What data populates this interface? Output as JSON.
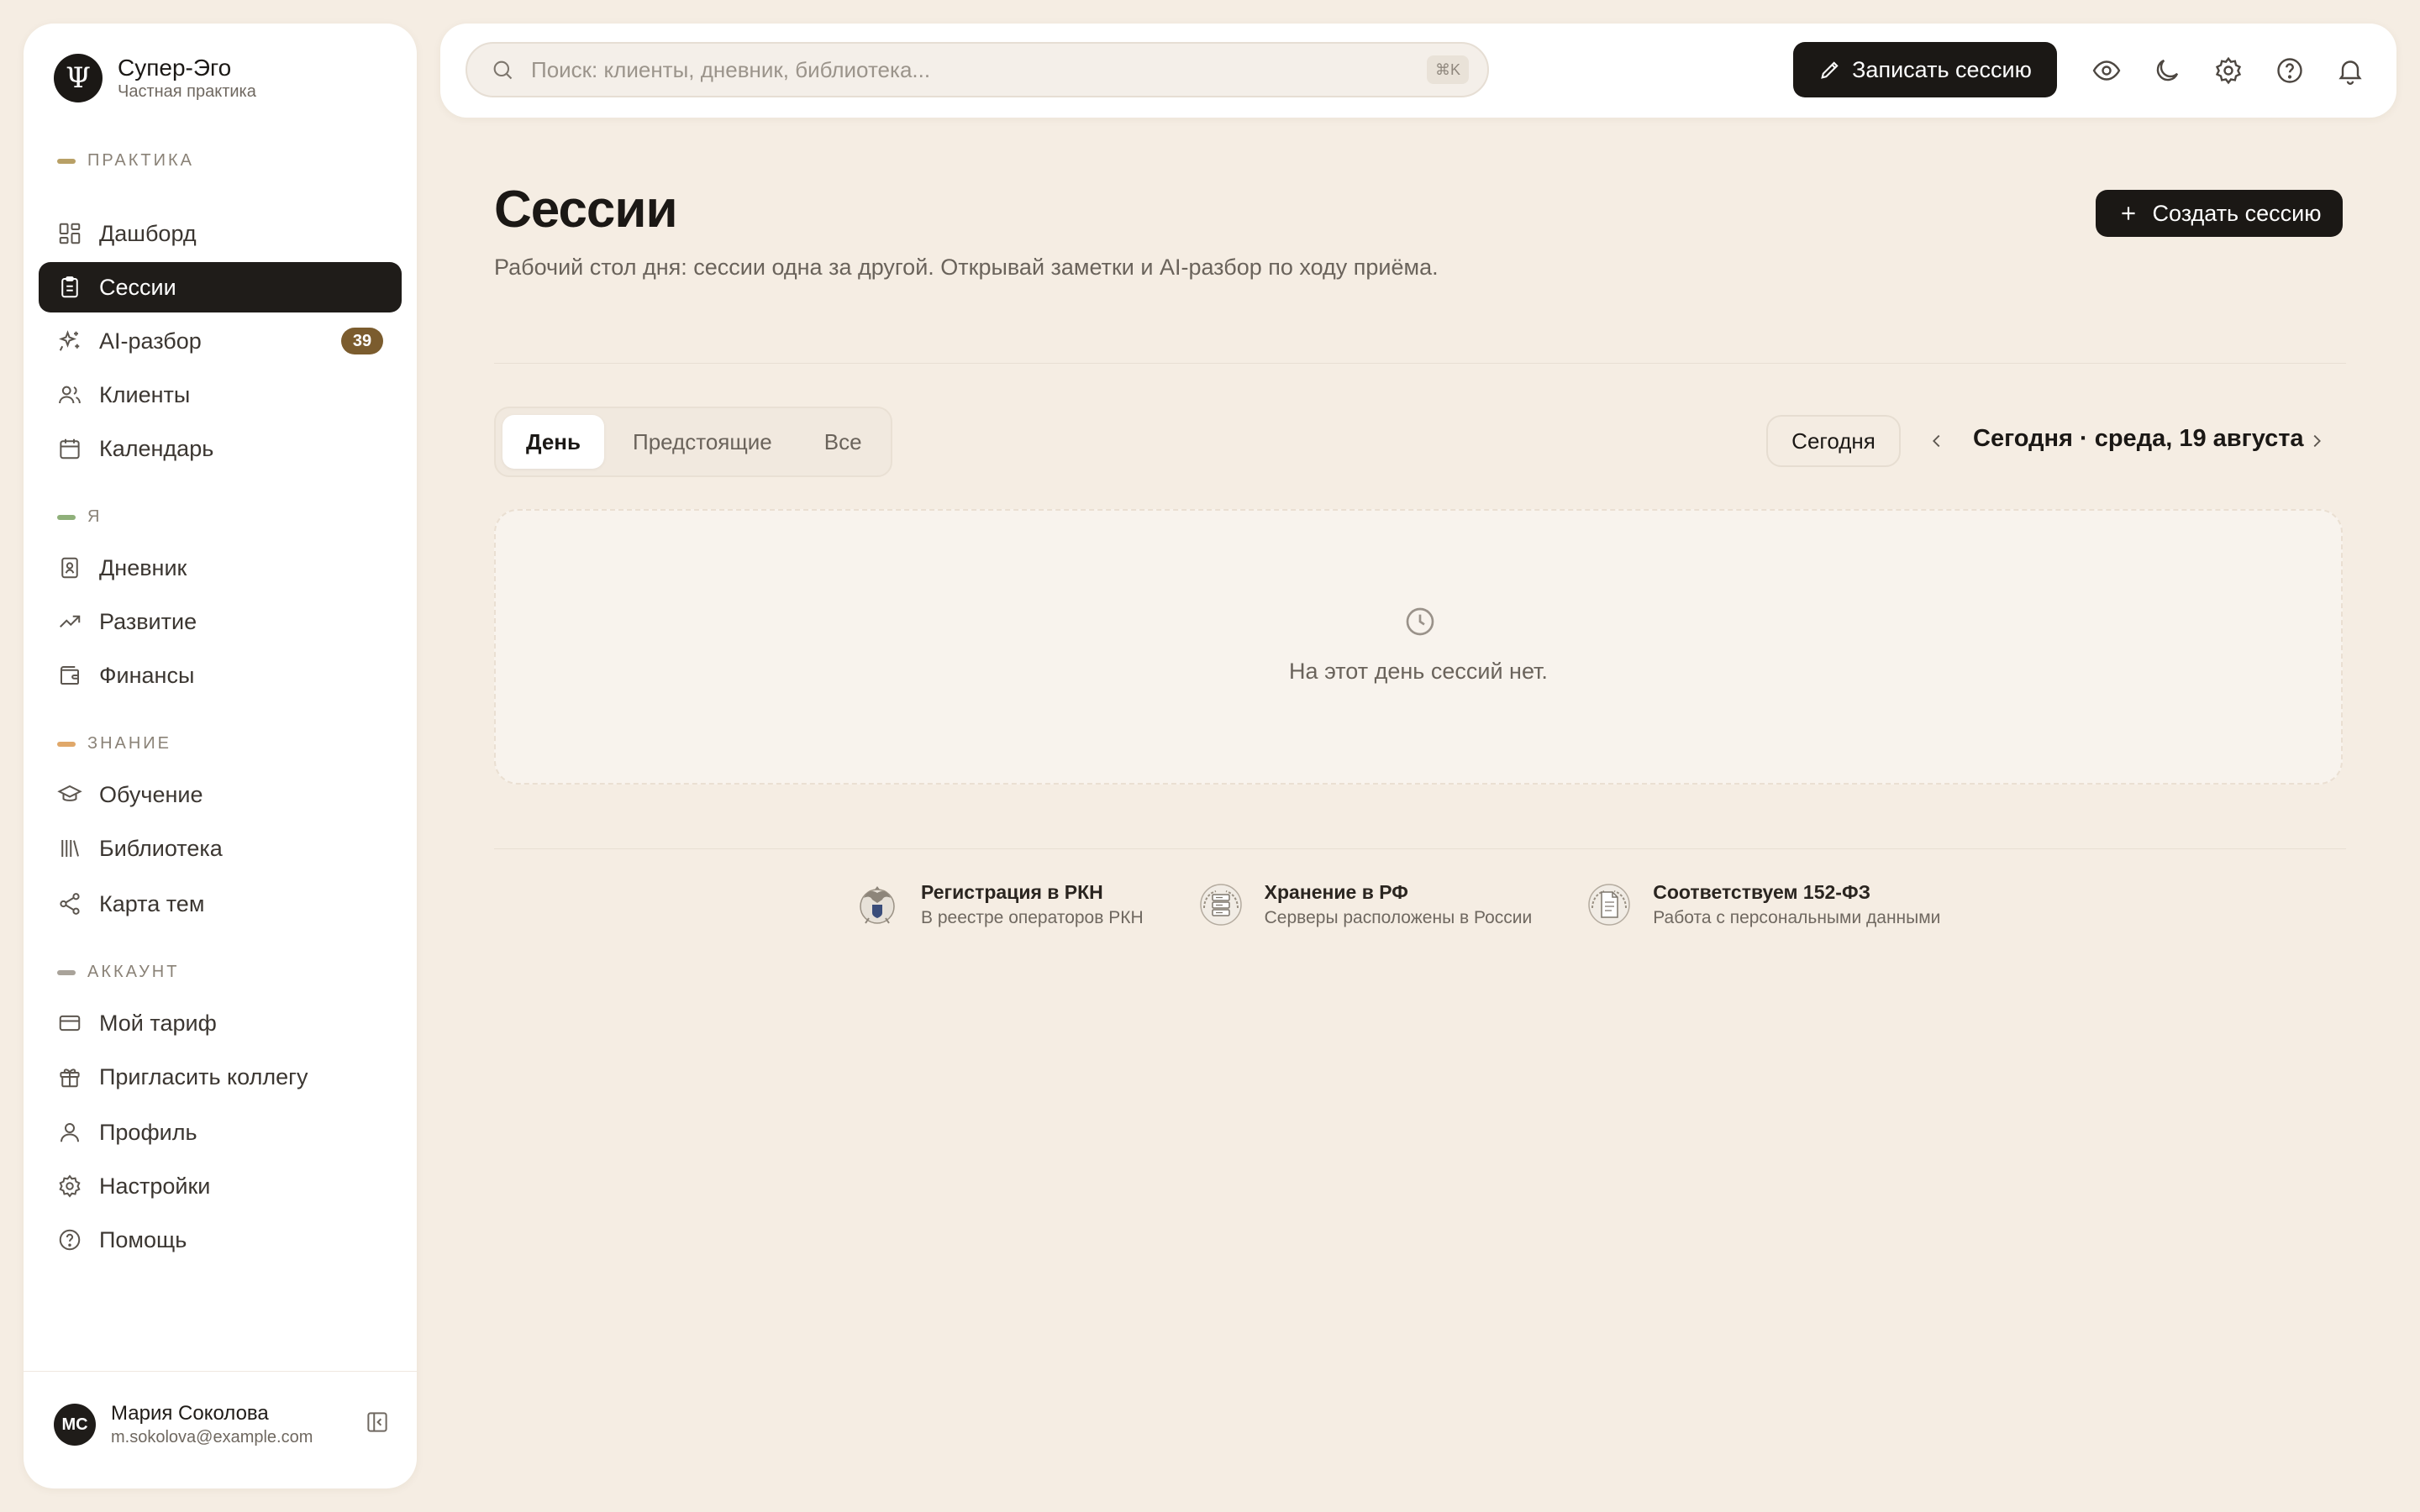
{
  "brand": {
    "name": "Супер-Эго",
    "subtitle": "Частная практика",
    "logo_glyph": "Ψ"
  },
  "sidebar": {
    "sections": [
      {
        "label": "ПРАКТИКА",
        "color": "#b8a066"
      },
      {
        "label": "Я",
        "color": "#8fb07a"
      },
      {
        "label": "ЗНАНИЕ",
        "color": "#e0a86a"
      },
      {
        "label": "АККАУНТ",
        "color": "#a9a39a"
      }
    ],
    "items": [
      {
        "label": "Дашборд",
        "icon": "dashboard-icon"
      },
      {
        "label": "Сессии",
        "icon": "clipboard-icon",
        "active": true
      },
      {
        "label": "AI-разбор",
        "icon": "sparkles-icon",
        "badge": "39"
      },
      {
        "label": "Клиенты",
        "icon": "users-icon"
      },
      {
        "label": "Календарь",
        "icon": "calendar-icon"
      },
      {
        "label": "Дневник",
        "icon": "journal-icon"
      },
      {
        "label": "Развитие",
        "icon": "trending-up-icon"
      },
      {
        "label": "Финансы",
        "icon": "wallet-icon"
      },
      {
        "label": "Обучение",
        "icon": "graduation-cap-icon"
      },
      {
        "label": "Библиотека",
        "icon": "library-icon"
      },
      {
        "label": "Карта тем",
        "icon": "share-nodes-icon"
      },
      {
        "label": "Мой тариф",
        "icon": "credit-card-icon"
      },
      {
        "label": "Пригласить коллегу",
        "icon": "gift-icon"
      },
      {
        "label": "Профиль",
        "icon": "user-icon"
      },
      {
        "label": "Настройки",
        "icon": "gear-icon"
      },
      {
        "label": "Помощь",
        "icon": "help-circle-icon"
      }
    ]
  },
  "user": {
    "initials": "МС",
    "name": "Мария Соколова",
    "email": "m.sokolova@example.com"
  },
  "topbar": {
    "search_placeholder": "Поиск: клиенты, дневник, библиотека...",
    "search_shortcut": "⌘K",
    "record_label": "Записать сессию"
  },
  "main": {
    "title": "Сессии",
    "subtitle": "Рабочий стол дня: сессии одна за другой. Открывай заметки и AI-разбор по ходу приёма.",
    "create_label": "Создать сессию",
    "tabs": [
      {
        "label": "День",
        "active": true
      },
      {
        "label": "Предстоящие"
      },
      {
        "label": "Все"
      }
    ],
    "today_label": "Сегодня",
    "date_label": "Сегодня · среда, 19 августа",
    "empty_text": "На этот день сессий нет."
  },
  "trust": [
    {
      "title": "Регистрация в РКН",
      "subtitle": "В реестре операторов РКН",
      "icon": "rkn-emblem-icon"
    },
    {
      "title": "Хранение в РФ",
      "subtitle": "Серверы расположены в России",
      "icon": "server-laurel-icon"
    },
    {
      "title": "Соответствуем 152-ФЗ",
      "subtitle": "Работа с персональными данными",
      "icon": "document-laurel-icon"
    }
  ],
  "colors": {
    "background": "#f5ede3",
    "dark": "#1b1815",
    "badge": "#7b5c2e"
  }
}
